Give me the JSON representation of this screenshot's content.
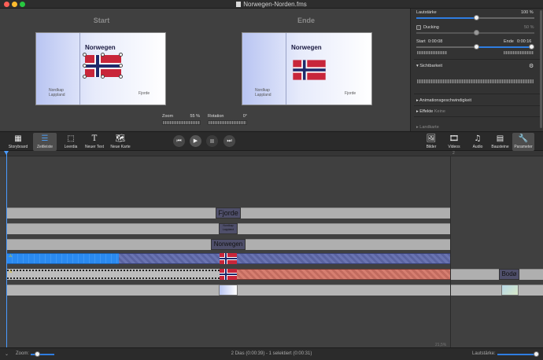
{
  "window": {
    "title": "Norwegen-Norden.fms"
  },
  "preview": {
    "start_label": "Start",
    "end_label": "Ende",
    "start_slide": {
      "title": "Norwegen",
      "left_caption_1": "Nordkap",
      "left_caption_2": "Lappland",
      "right_caption": "Fjorde"
    },
    "end_slide": {
      "title": "Norwegen",
      "left_caption_1": "Nordkap",
      "left_caption_2": "Lappland",
      "right_caption": "Fjorde"
    },
    "zoom": {
      "label": "Zoom",
      "value": "55 %"
    },
    "rotation": {
      "label": "Rotation",
      "value": "0°"
    }
  },
  "inspector": {
    "volume": {
      "label": "Lautstärke",
      "value": "100 %"
    },
    "ducking": {
      "label": "Ducking",
      "value": "50 %"
    },
    "start": {
      "label": "Start",
      "value": "0:00:08"
    },
    "end": {
      "label": "Ende",
      "value": "0:00:16"
    },
    "visibility": {
      "label": "Sichtbarkeit"
    },
    "animation_speed": {
      "label": "Animationsgeschwindigkeit"
    },
    "effects": {
      "label": "Effekte",
      "value": "Keine"
    },
    "map": {
      "label": "Landkarte"
    }
  },
  "toolbar": {
    "storyboard": "Storyboard",
    "timeline": "Zeitleiste",
    "blank_slide": "Leerdia",
    "new_text": "Neuer Text",
    "new_map": "Neue Karte",
    "images": "Bilder",
    "videos": "Videos",
    "audio": "Audio",
    "blocks": "Bausteine",
    "parameters": "Parameter"
  },
  "timeline": {
    "marker_2": "2",
    "track_fjorde": "Fjorde",
    "track_nordkap": "Nordkap\nLappland",
    "track_norwegen": "Norwegen",
    "track_bodo": "Bodø",
    "zoom_percent": "21,5%"
  },
  "status": {
    "zoom_label": "Zoom:",
    "info": "2 Dias (0:00:39) - 1 selektiert (0:00:31)",
    "volume_label": "Lautstärke:"
  }
}
